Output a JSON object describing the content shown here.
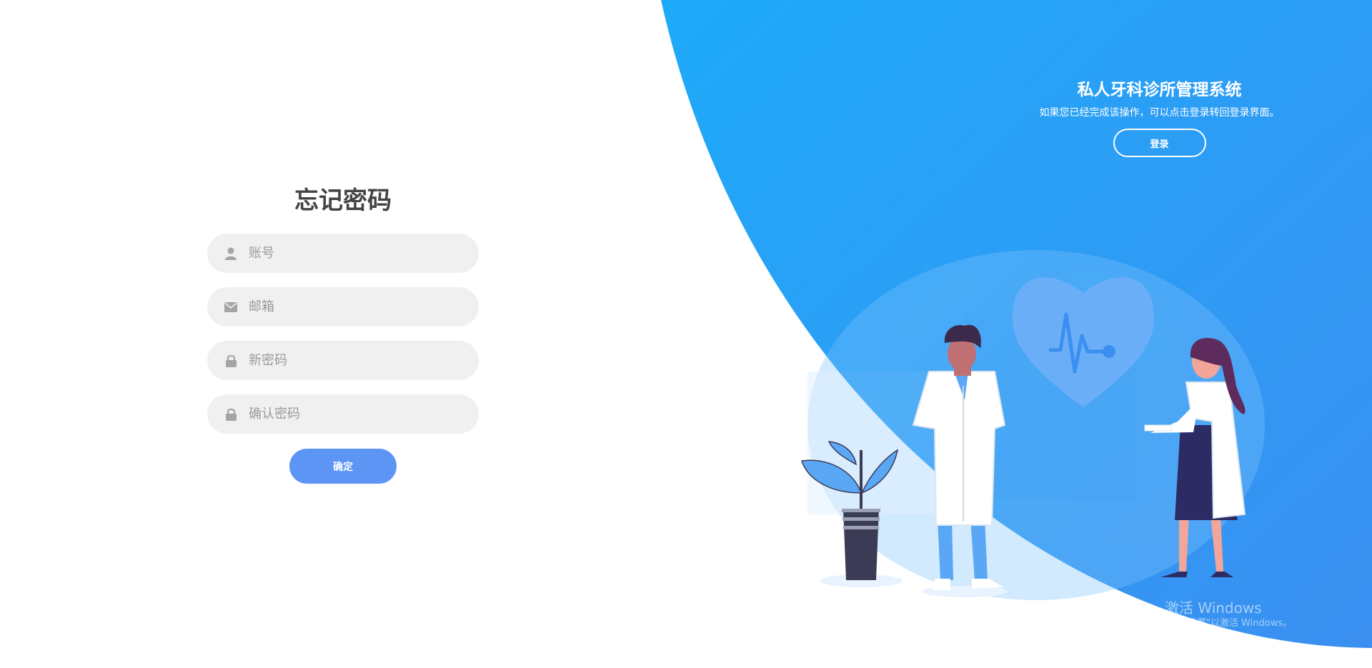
{
  "app": {
    "title": "私人牙科诊所管理系统",
    "subtitle": "如果您已经完成该操作，可以点击登录转回登录界面。",
    "login_label": "登录"
  },
  "form": {
    "title": "忘记密码",
    "fields": [
      {
        "placeholder": "账号",
        "icon": "user-icon",
        "value": ""
      },
      {
        "placeholder": "邮箱",
        "icon": "envelope-icon",
        "value": ""
      },
      {
        "placeholder": "新密码",
        "icon": "lock-icon",
        "value": ""
      },
      {
        "placeholder": "确认密码",
        "icon": "lock-icon",
        "value": ""
      }
    ],
    "confirm_label": "确定"
  },
  "watermark": {
    "title": "激活 Windows",
    "subtitle": "转到\"设置\"以激活 Windows。"
  },
  "colors": {
    "primary_blue": "#1e9ef5",
    "button_blue": "#5d95f5",
    "input_bg": "#f0f0f0"
  }
}
